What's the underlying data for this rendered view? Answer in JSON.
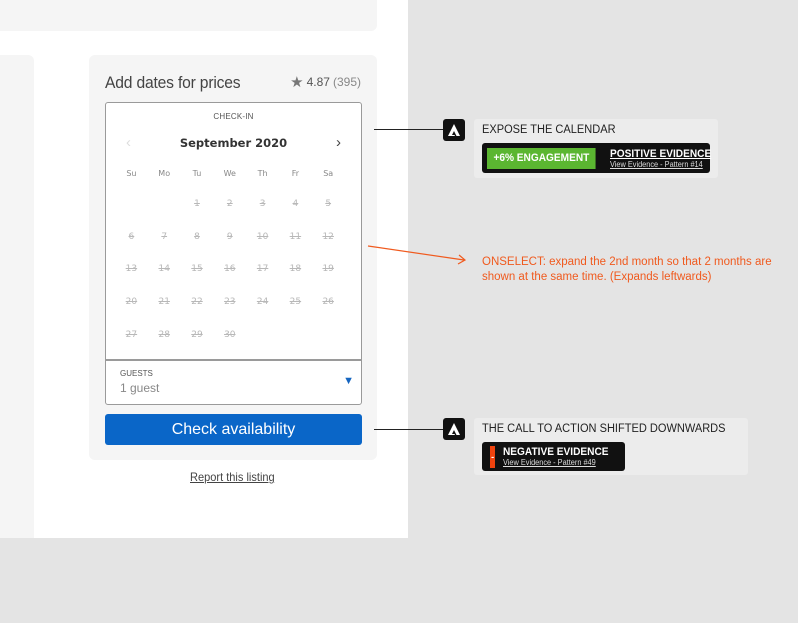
{
  "booking": {
    "title": "Add dates for prices",
    "rating_value": "4.87",
    "rating_count": "(395)",
    "checkin_label": "CHECK-IN",
    "month": "September 2020",
    "prev_icon": "chevron-left-icon",
    "next_icon": "chevron-right-icon",
    "weekdays": [
      "Su",
      "Mo",
      "Tu",
      "We",
      "Th",
      "Fr",
      "Sa"
    ],
    "weeks": [
      [
        "",
        "",
        "1",
        "2",
        "3",
        "4",
        "5"
      ],
      [
        "6",
        "7",
        "8",
        "9",
        "10",
        "11",
        "12"
      ],
      [
        "13",
        "14",
        "15",
        "16",
        "17",
        "18",
        "19"
      ],
      [
        "20",
        "21",
        "22",
        "23",
        "24",
        "25",
        "26"
      ],
      [
        "27",
        "28",
        "29",
        "30",
        "",
        "",
        ""
      ]
    ],
    "guests_label": "GUESTS",
    "guests_value": "1 guest",
    "cta_label": "Check availability",
    "report_link": "Report this listing"
  },
  "annotations": {
    "calendar": {
      "title": "EXPOSE THE CALENDAR",
      "pill": "+6% ENGAGEMENT",
      "evidence_heading": "POSITIVE EVIDENCE",
      "evidence_link": "View Evidence - Pattern #14"
    },
    "onselect_note": "ONSELECT: expand the 2nd month so that 2 months are shown at the same time. (Expands leftwards)",
    "cta": {
      "title": "THE CALL TO ACTION SHIFTED DOWNWARDS",
      "pill": "-",
      "evidence_heading": "NEGATIVE EVIDENCE",
      "evidence_link": "View Evidence - Pattern #49"
    }
  },
  "colors": {
    "cta_blue": "#0a66c8",
    "positive_green": "#5bb631",
    "negative_orange": "#f0430e",
    "note_orange": "#f05a1e"
  }
}
